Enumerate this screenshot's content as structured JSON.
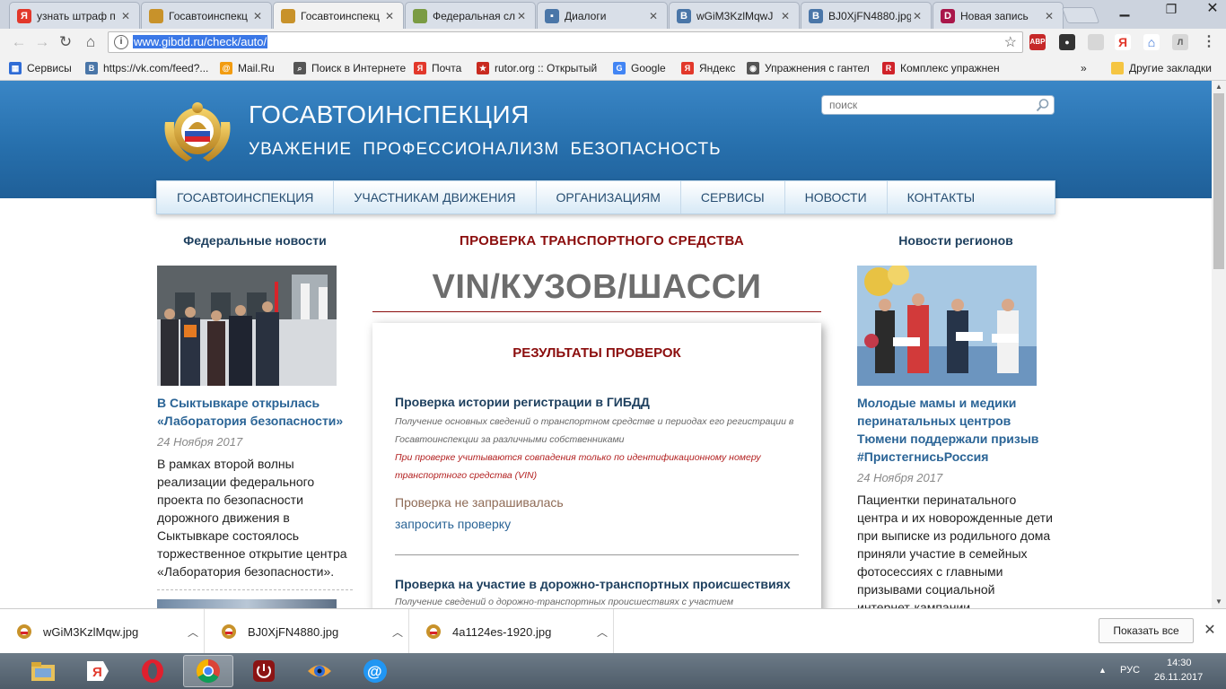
{
  "browser": {
    "tabs": [
      {
        "title": "узнать штраф п",
        "icon": "yandex-icon",
        "color": "#e2382b",
        "glyph": "Я"
      },
      {
        "title": "Госавтоинспекц",
        "icon": "gibdd-emblem-icon",
        "color": "#c8922a",
        "glyph": ""
      },
      {
        "title": "Госавтоинспекц",
        "icon": "gibdd-emblem-icon",
        "color": "#c8922a",
        "glyph": "",
        "active": true
      },
      {
        "title": "Федеральная сл",
        "icon": "eagle-emblem-icon",
        "color": "#7a9b43",
        "glyph": ""
      },
      {
        "title": "Диалоги",
        "icon": "vk-dialogs-icon",
        "color": "#4a76a8",
        "glyph": "▪"
      },
      {
        "title": "wGiM3KzlMqwJ",
        "icon": "vk-icon",
        "color": "#4a76a8",
        "glyph": "В"
      },
      {
        "title": "BJ0XjFN4880.jpg",
        "icon": "vk-icon",
        "color": "#4a76a8",
        "glyph": "В"
      },
      {
        "title": "Новая запись",
        "icon": "d-icon",
        "color": "#a9174a",
        "glyph": "D"
      }
    ],
    "address": "www.gibdd.ru/check/auto/",
    "bookmarks": [
      {
        "label": "Сервисы",
        "icon": "apps-icon",
        "color": "#2f6cd6",
        "glyph": "▦"
      },
      {
        "label": "https://vk.com/feed?...",
        "icon": "vk-icon",
        "color": "#4a76a8",
        "glyph": "В"
      },
      {
        "label": "Mail.Ru",
        "icon": "mailru-icon",
        "color": "#f29c11",
        "glyph": "@"
      },
      {
        "label": "Поиск в Интернете",
        "icon": "search-icon",
        "color": "#555555",
        "glyph": "⌕"
      },
      {
        "label": "Почта",
        "icon": "yandex-mail-icon",
        "color": "#e2382b",
        "glyph": "Я"
      },
      {
        "label": "rutor.org :: Открытый",
        "icon": "rutor-icon",
        "color": "#c82a1f",
        "glyph": "★"
      },
      {
        "label": "Google",
        "icon": "google-icon",
        "color": "#4285f4",
        "glyph": "G"
      },
      {
        "label": "Яндекс",
        "icon": "yandex-icon",
        "color": "#e2382b",
        "glyph": "Я"
      },
      {
        "label": "Упражнения с гантел",
        "icon": "dumbbell-icon",
        "color": "#555555",
        "glyph": "◉"
      },
      {
        "label": "Комплекс упражнен",
        "icon": "r-icon",
        "color": "#d0232a",
        "glyph": "R"
      }
    ],
    "other_bookmarks": "Другие закладки",
    "more": "»"
  },
  "site": {
    "brand": "ГОСАВТОИНСПЕКЦИЯ",
    "slogan": "УВАЖЕНИЕ  ПРОФЕССИОНАЛИЗМ  БЕЗОПАСНОСТЬ",
    "search_placeholder": "поиск",
    "menu": [
      "ГОСАВТОИНСПЕКЦИЯ",
      "УЧАСТНИКАМ ДВИЖЕНИЯ",
      "ОРГАНИЗАЦИЯМ",
      "СЕРВИСЫ",
      "НОВОСТИ",
      "КОНТАКТЫ"
    ],
    "left": {
      "heading": "Федеральные новости",
      "title": "В Сыктывкаре открылась «Лаборатория безопасности»",
      "date": "24 Ноября 2017",
      "text": "В рамках второй волны реализации федерального проекта по безопасности дорожного движения в Сыктывкаре состоялось торжественное открытие центра «Лаборатория безопасности»."
    },
    "right": {
      "heading": "Новости регионов",
      "title": "Молодые мамы и медики перинатальных центров Тюмени поддержали призыв #ПристегнисьРоссия",
      "date": "24 Ноября 2017",
      "text": "Пациентки перинатального центра и их новорожденные дети при выписке из родильного дома приняли участие в семейных фотосессиях с главными призывами социальной интернет-кампании"
    },
    "center": {
      "heading": "ПРОВЕРКА ТРАНСПОРТНОГО СРЕДСТВА",
      "vin_label": "VIN/КУЗОВ/ШАССИ",
      "results_heading": "РЕЗУЛЬТАТЫ ПРОВЕРОК",
      "check1_title": "Проверка истории регистрации в ГИБДД",
      "check1_desc": "Получение основных сведений о транспортном средстве и периодах его регистрации в Госавтоинспекции за различными собственниками",
      "check1_note": "При проверке учитываются совпадения только по идентификационному номеру транспортного средства (VIN)",
      "check1_status": "Проверка не запрашивалась",
      "check1_link": "запросить проверку",
      "check2_title": "Проверка на участие в дорожно-транспортных происшествиях",
      "check2_desc": "Получение сведений о дорожно-транспортных происшествиях с участием"
    }
  },
  "downloads": {
    "items": [
      "wGiM3KzlMqw.jpg",
      "BJ0XjFN4880.jpg",
      "4a1124es-1920.jpg"
    ],
    "show_all": "Показать все"
  },
  "taskbar": {
    "lang": "РУС",
    "time": "14:30",
    "date": "26.11.2017"
  }
}
